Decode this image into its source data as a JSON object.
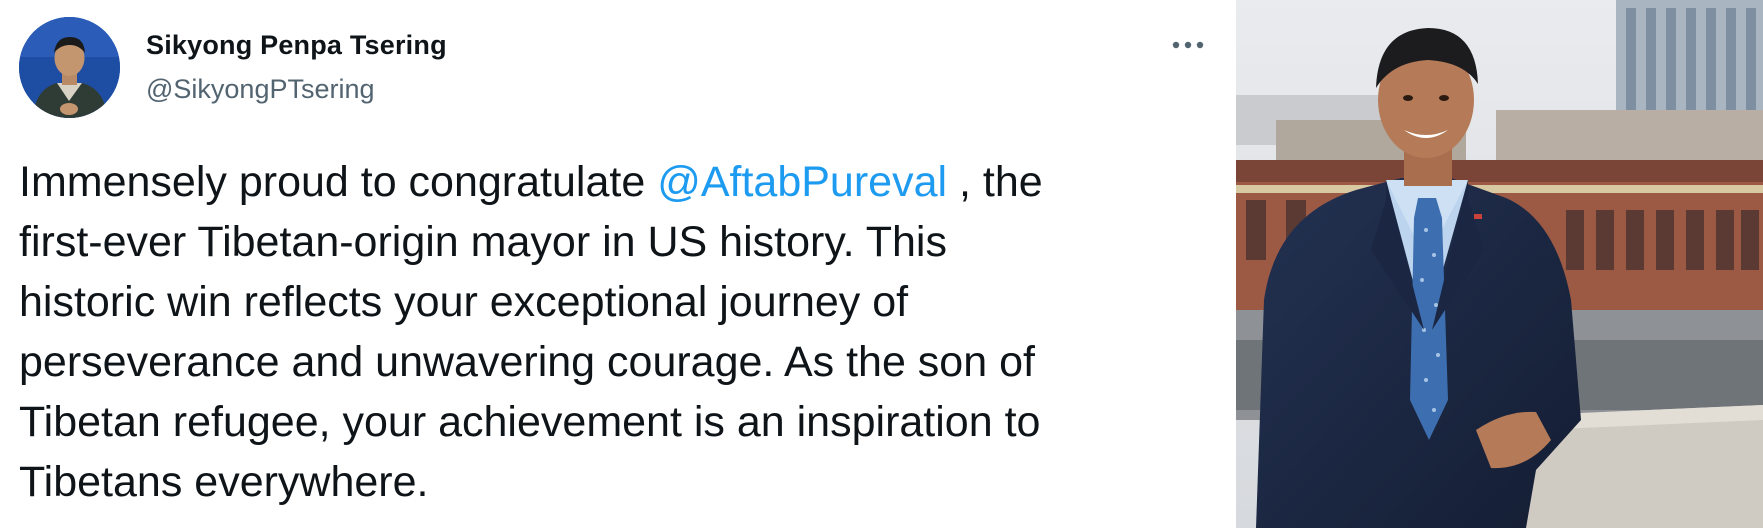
{
  "tweet": {
    "author": {
      "display_name": "Sikyong Penpa Tsering",
      "handle": "@SikyongPTsering",
      "avatar_icon": "profile-photo"
    },
    "more_icon": "more-horizontal-icon",
    "text_lines": [
      {
        "before": "Immensely proud to congratulate ",
        "mention": "@AftabPureval",
        "after": " , the"
      },
      {
        "text": "first-ever Tibetan-origin mayor in US history. This"
      },
      {
        "text": "historic win reflects your exceptional journey of"
      },
      {
        "text": "perseverance and unwavering courage. As the son of"
      },
      {
        "text": "Tibetan refugee, your achievement is an inspiration to"
      },
      {
        "text": "Tibetans everywhere."
      }
    ],
    "colors": {
      "text": "#0f1419",
      "secondary": "#536471",
      "mention": "#1d9bf0"
    }
  },
  "photo": {
    "subject": "man in navy suit and blue polka-dot tie on a rooftop"
  }
}
